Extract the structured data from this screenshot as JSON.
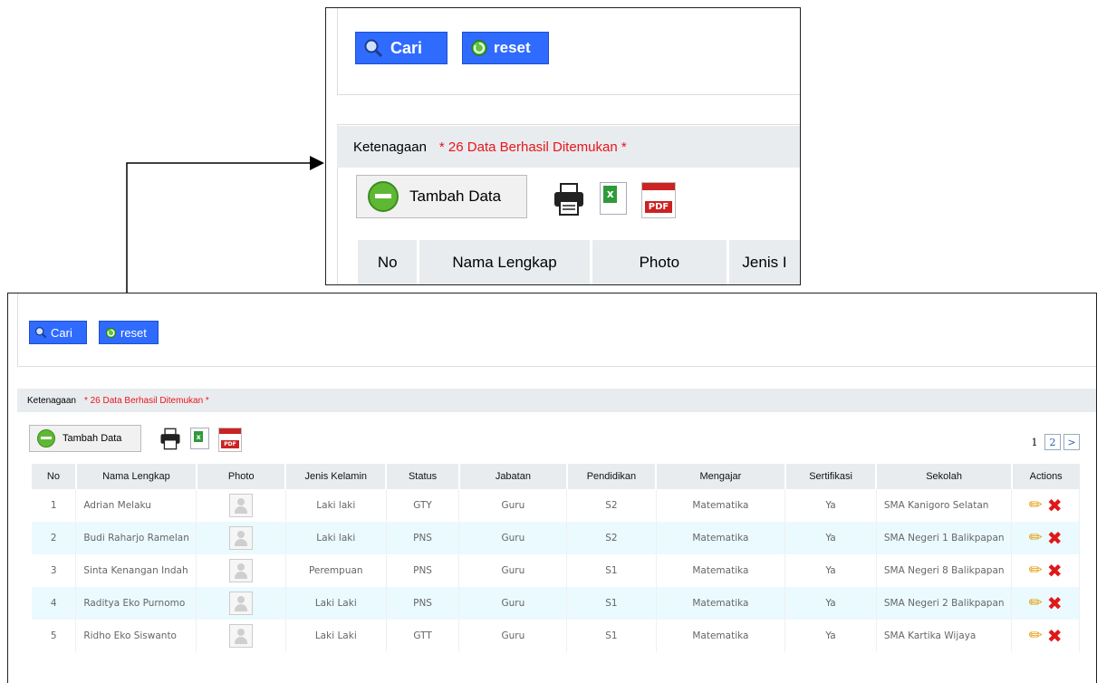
{
  "search": {
    "cari_label": "Cari",
    "reset_label": "reset"
  },
  "panel": {
    "title": "Ketenagaan",
    "found_text": "* 26 Data Berhasil Ditemukan *",
    "add_label": "Tambah Data"
  },
  "zoom_headers": [
    "No",
    "Nama Lengkap",
    "Photo",
    "Jenis I"
  ],
  "pager": {
    "current": "1",
    "page2": "2",
    "next": ">"
  },
  "table": {
    "headers": [
      "No",
      "Nama Lengkap",
      "Photo",
      "Jenis Kelamin",
      "Status",
      "Jabatan",
      "Pendidikan",
      "Mengajar",
      "Sertifikasi",
      "Sekolah",
      "Actions"
    ],
    "rows": [
      {
        "no": "1",
        "nama": "Adrian Melaku",
        "jk": "Laki laki",
        "status": "GTY",
        "jabatan": "Guru",
        "pendidikan": "S2",
        "mengajar": "Matematika",
        "sertifikasi": "Ya",
        "sekolah": "SMA Kanigoro Selatan"
      },
      {
        "no": "2",
        "nama": "Budi Raharjo Ramelan",
        "jk": "Laki laki",
        "status": "PNS",
        "jabatan": "Guru",
        "pendidikan": "S2",
        "mengajar": "Matematika",
        "sertifikasi": "Ya",
        "sekolah": "SMA Negeri 1 Balikpapan"
      },
      {
        "no": "3",
        "nama": "Sinta Kenangan Indah",
        "jk": "Perempuan",
        "status": "PNS",
        "jabatan": "Guru",
        "pendidikan": "S1",
        "mengajar": "Matematika",
        "sertifikasi": "Ya",
        "sekolah": "SMA Negeri 8 Balikpapan"
      },
      {
        "no": "4",
        "nama": "Raditya Eko Purnomo",
        "jk": "Laki Laki",
        "status": "PNS",
        "jabatan": "Guru",
        "pendidikan": "S1",
        "mengajar": "Matematika",
        "sertifikasi": "Ya",
        "sekolah": "SMA Negeri 2 Balikpapan"
      },
      {
        "no": "5",
        "nama": "Ridho Eko Siswanto",
        "jk": "Laki Laki",
        "status": "GTT",
        "jabatan": "Guru",
        "pendidikan": "S1",
        "mengajar": "Matematika",
        "sertifikasi": "Ya",
        "sekolah": "SMA Kartika Wijaya"
      }
    ]
  },
  "icons": [
    "search-icon",
    "reset-icon",
    "add-icon",
    "print-icon",
    "excel-icon",
    "pdf-icon",
    "edit-icon",
    "delete-icon",
    "user-placeholder-icon"
  ],
  "colors": {
    "button_blue": "#2f6bff",
    "found_red": "#e8151b",
    "row_alt": "#eafaff",
    "header_gray": "#e9ecef"
  }
}
